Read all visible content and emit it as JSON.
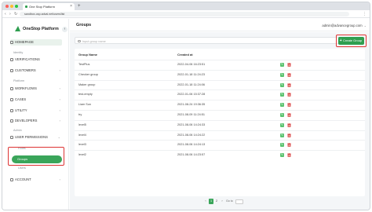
{
  "browser": {
    "tab_title": "One Stop Platform",
    "tab_close": "×",
    "new_tab": "+",
    "url": "sandbox-osp.advai.net/users/list",
    "back": "‹",
    "forward": "›",
    "reload": "↻",
    "menu": "⋮"
  },
  "colors": {
    "brand_green": "#2e9e4f",
    "highlight_red": "#dd3333"
  },
  "sidebar": {
    "logo_text": "OneStop Platform",
    "collapse": "‹",
    "homepage": "HOMEPAGE",
    "sections": {
      "identity": "Identity",
      "platform": "Platform",
      "admin": "Admin"
    },
    "identity_items": [
      "VERIFICATIONS",
      "CUSTOMERS"
    ],
    "platform_items": [
      "WORKFLOWS",
      "CASES",
      "UTILITY",
      "DEVELOPERS"
    ],
    "user_permissions": "USER PERMISSIONS",
    "sub_items": {
      "roles": "Roles",
      "groups": "Groups",
      "users": "Users"
    },
    "account": "ACCOUNT"
  },
  "header": {
    "title": "Groups",
    "account_email": "admin@advancegroup.com",
    "account_chevron": "⌄"
  },
  "toolbar": {
    "search_placeholder": "Input group name",
    "create_label": "Create Group",
    "create_icon": "+"
  },
  "table": {
    "columns": [
      "Group Name",
      "Created at"
    ],
    "rows": [
      {
        "name": "TestPlus",
        "created": "2022-04-06 16:23:51"
      },
      {
        "name": "Checker group",
        "created": "2022-01-18 11:24:23"
      },
      {
        "name": "Maker group",
        "created": "2022-01-18 11:24:06"
      },
      {
        "name": "test-empty",
        "created": "2022-01-06 15:37:28"
      },
      {
        "name": "Liam Sun",
        "created": "2021-08-24 19:36:35"
      },
      {
        "name": "try",
        "created": "2021-08-09 11:24:51"
      },
      {
        "name": "level5",
        "created": "2021-08-06 14:24:33"
      },
      {
        "name": "level4",
        "created": "2021-08-06 14:24:22"
      },
      {
        "name": "level3",
        "created": "2021-08-06 14:24:13"
      },
      {
        "name": "level2",
        "created": "2021-08-06 14:23:57"
      }
    ],
    "edit_icon": "✎",
    "delete_icon": "🗑"
  },
  "pagination": {
    "prev": "‹",
    "pages": [
      "1",
      "2"
    ],
    "current": "1",
    "next": "›",
    "goto_label": "Go to"
  }
}
